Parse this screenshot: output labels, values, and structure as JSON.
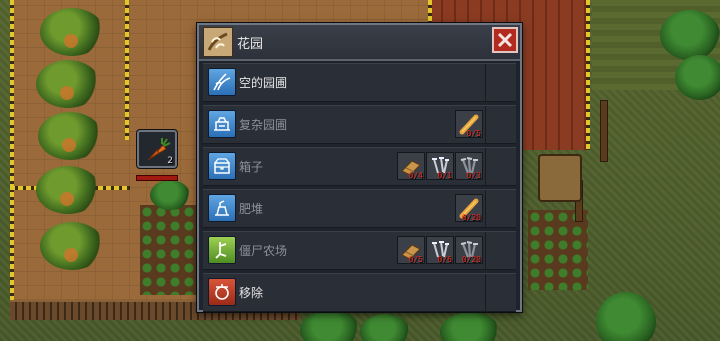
{
  "window": {
    "title": "花园"
  },
  "inventory": {
    "slot_count": "2"
  },
  "build_items": [
    {
      "label": "空的园圃",
      "enabled": true,
      "icon": "empty-garden-icon",
      "resources": []
    },
    {
      "label": "复杂园圃",
      "enabled": false,
      "icon": "complex-garden-icon",
      "resources": [
        {
          "icon": "timber-icon",
          "count": "0/5"
        }
      ]
    },
    {
      "label": "箱子",
      "enabled": false,
      "icon": "chest-icon",
      "resources": [
        {
          "icon": "planks-icon",
          "count": "0/4"
        },
        {
          "icon": "nails-icon",
          "count": "0/1"
        },
        {
          "icon": "iron-nails-icon",
          "count": "0/3"
        }
      ]
    },
    {
      "label": "肥堆",
      "enabled": false,
      "icon": "compost-icon",
      "resources": [
        {
          "icon": "timber-icon",
          "count": "0/20"
        }
      ]
    },
    {
      "label": "僵尸农场",
      "enabled": false,
      "icon": "zombie-farm-icon",
      "resources": [
        {
          "icon": "planks-icon",
          "count": "0/5"
        },
        {
          "icon": "nails-icon",
          "count": "0/6"
        },
        {
          "icon": "iron-nails-icon",
          "count": "0/20"
        }
      ]
    },
    {
      "label": "移除",
      "enabled": true,
      "icon": "remove-icon",
      "resources": []
    }
  ],
  "colors": {
    "panel_bg": "#1f232b",
    "row_bg": "#2a2f37",
    "close_button": "#b32a1e",
    "resource_count": "#e8261a",
    "enabled_text": "#e6e6e6",
    "disabled_text": "#8c919a"
  }
}
